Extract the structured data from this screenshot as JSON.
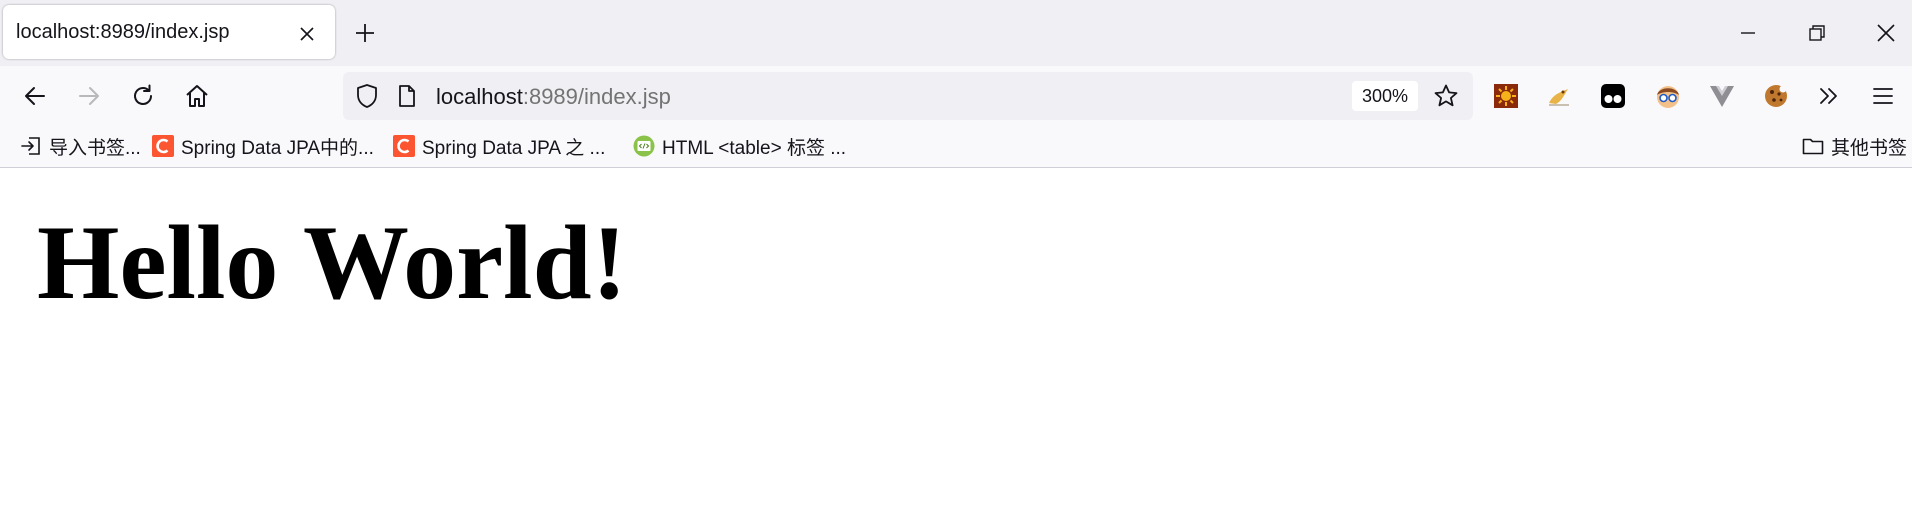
{
  "tab": {
    "title": "localhost:8989/index.jsp",
    "close_icon": "close-icon",
    "new_tab_icon": "plus-icon"
  },
  "window_controls": {
    "minimize_icon": "minimize-icon",
    "restore_icon": "restore-icon",
    "close_icon": "close-icon"
  },
  "nav": {
    "back_icon": "arrow-left-icon",
    "forward_icon": "arrow-right-icon",
    "reload_icon": "reload-icon",
    "home_icon": "home-icon"
  },
  "urlbar": {
    "host": "localhost",
    "path": ":8989/index.jsp",
    "zoom": "300%",
    "shield_icon": "shield-icon",
    "page_icon": "page-icon",
    "bookmark_star_icon": "star-icon"
  },
  "extensions": [
    {
      "name": "extension-sun-icon"
    },
    {
      "name": "extension-bird-icon"
    },
    {
      "name": "extension-tampermonkey-icon"
    },
    {
      "name": "extension-glasses-face-icon"
    },
    {
      "name": "extension-vue-devtools-icon"
    },
    {
      "name": "extension-cookie-icon"
    }
  ],
  "overflow_icon": "chevrons-right-icon",
  "menu_icon": "hamburger-menu-icon",
  "bookmarks": {
    "items": [
      {
        "label": "导入书签...",
        "icon": "import-icon"
      },
      {
        "label": "Spring Data JPA中的...",
        "icon": "csdn-icon"
      },
      {
        "label": "Spring Data JPA 之 ...",
        "icon": "csdn-icon"
      },
      {
        "label": "HTML <table> 标签 ...",
        "icon": "html-code-icon"
      }
    ],
    "other": {
      "label": "其他书签",
      "icon": "folder-icon"
    }
  },
  "page": {
    "heading": "Hello World!"
  },
  "colors": {
    "tabstrip_bg": "#f0f0f4",
    "toolbar_bg": "#f9f9fb",
    "csdn_red": "#fc5531",
    "text": "#15141a"
  }
}
